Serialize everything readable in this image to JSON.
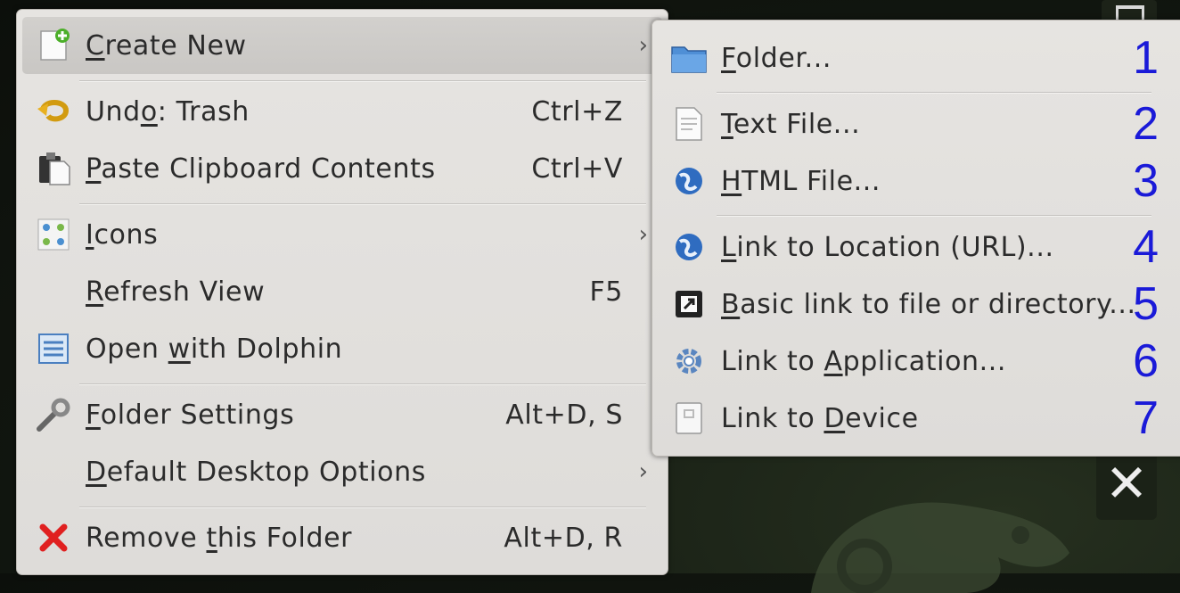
{
  "background": {
    "close_glyph": "✕"
  },
  "main_menu": {
    "items": [
      {
        "label_pre": "",
        "label_u": "C",
        "label_post": "reate New",
        "shortcut": "",
        "arrow": "›",
        "icon": "new-document-icon"
      },
      {
        "label_pre": "Und",
        "label_u": "o",
        "label_post": ": Trash",
        "shortcut": "Ctrl+Z",
        "arrow": "",
        "icon": "undo-icon"
      },
      {
        "label_pre": "",
        "label_u": "P",
        "label_post": "aste Clipboard Contents",
        "shortcut": "Ctrl+V",
        "arrow": "",
        "icon": "paste-icon"
      },
      {
        "label_pre": "",
        "label_u": "I",
        "label_post": "cons",
        "shortcut": "",
        "arrow": "›",
        "icon": "icons-view-icon"
      },
      {
        "label_pre": "",
        "label_u": "R",
        "label_post": "efresh View",
        "shortcut": "F5",
        "arrow": "",
        "icon": ""
      },
      {
        "label_pre": "Open ",
        "label_u": "w",
        "label_post": "ith Dolphin",
        "shortcut": "",
        "arrow": "",
        "icon": "dolphin-icon"
      },
      {
        "label_pre": "",
        "label_u": "F",
        "label_post": "older Settings",
        "shortcut": "Alt+D, S",
        "arrow": "",
        "icon": "wrench-icon"
      },
      {
        "label_pre": "",
        "label_u": "D",
        "label_post": "efault Desktop Options",
        "shortcut": "",
        "arrow": "›",
        "icon": ""
      },
      {
        "label_pre": "Remove ",
        "label_u": "t",
        "label_post": "his Folder",
        "shortcut": "Alt+D, R",
        "arrow": "",
        "icon": "remove-icon"
      }
    ]
  },
  "sub_menu": {
    "items": [
      {
        "label_pre": "",
        "label_u": "F",
        "label_post": "older...",
        "number": "1",
        "icon": "folder-icon"
      },
      {
        "label_pre": "",
        "label_u": "T",
        "label_post": "ext File...",
        "number": "2",
        "icon": "text-file-icon"
      },
      {
        "label_pre": "",
        "label_u": "H",
        "label_post": "TML File...",
        "number": "3",
        "icon": "html-globe-icon"
      },
      {
        "label_pre": "",
        "label_u": "L",
        "label_post": "ink to Location (URL)...",
        "number": "4",
        "icon": "globe-link-icon"
      },
      {
        "label_pre": "",
        "label_u": "B",
        "label_post": "asic link to file or directory...",
        "number": "5",
        "icon": "basic-link-icon"
      },
      {
        "label_pre": "Link to ",
        "label_u": "A",
        "label_post": "pplication...",
        "number": "6",
        "icon": "application-gear-icon"
      },
      {
        "label_pre": "Link to ",
        "label_u": "D",
        "label_post": "evice",
        "number": "7",
        "number_arrow": "›",
        "icon": "device-icon"
      }
    ]
  },
  "colors": {
    "menu_bg": "#e2e0dd",
    "highlight": "#cdcbc8",
    "number_blue": "#1a1ad8",
    "desktop_bg": "#141a12"
  }
}
